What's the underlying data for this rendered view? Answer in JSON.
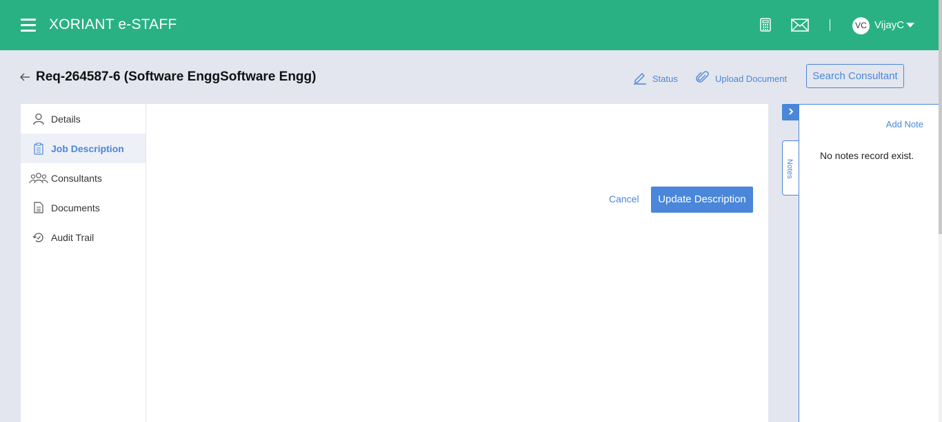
{
  "header": {
    "app_title": "XORIANT e-STAFF",
    "user_initials": "VC",
    "user_name": "VijayC",
    "icons": [
      "menu-icon",
      "calculator-icon",
      "mail-icon",
      "chevron-down-icon"
    ]
  },
  "page": {
    "title": "Req-264587-6 (Software EnggSoftware Engg)",
    "actions": {
      "status": "Status",
      "upload_document": "Upload Document",
      "search_consultant": "Search Consultant"
    }
  },
  "sidebar": {
    "items": [
      {
        "label": "Details",
        "icon": "user-icon",
        "active": false
      },
      {
        "label": "Job Description",
        "icon": "clipboard-icon",
        "active": true
      },
      {
        "label": "Consultants",
        "icon": "users-icon",
        "active": false
      },
      {
        "label": "Documents",
        "icon": "document-icon",
        "active": false
      },
      {
        "label": "Audit Trail",
        "icon": "history-icon",
        "active": false
      }
    ]
  },
  "editor": {
    "cancel_label": "Cancel",
    "update_label": "Update Description"
  },
  "notes": {
    "tab_label": "Notes",
    "add_label": "Add Note",
    "empty_message": "No notes record exist."
  },
  "colors": {
    "header_bg": "#29b184",
    "accent": "#4a86d9",
    "page_bg": "#e3e6ef"
  }
}
